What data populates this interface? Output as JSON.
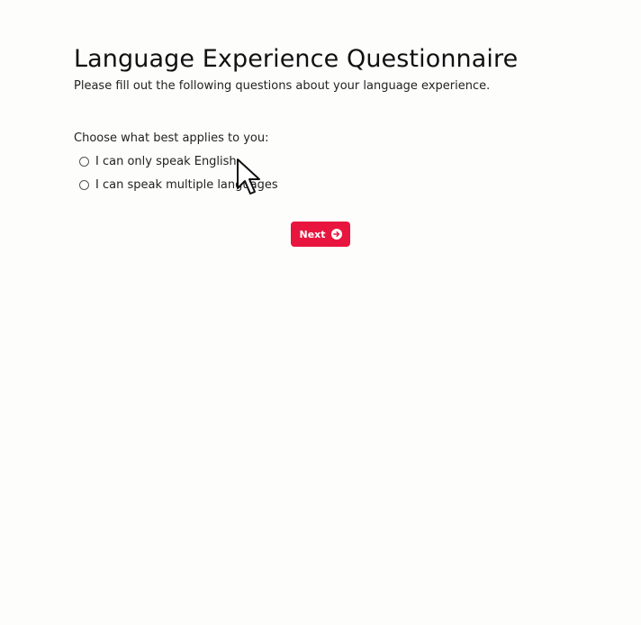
{
  "page": {
    "title": "Language Experience Questionnaire",
    "subtitle": "Please fill out the following questions about your language experience."
  },
  "question": {
    "label": "Choose what best applies to you:",
    "options": [
      {
        "label": "I can only speak English",
        "selected": false
      },
      {
        "label": "I can speak multiple languages",
        "selected": false
      }
    ]
  },
  "actions": {
    "next_label": "Next",
    "next_icon": "arrow-circle-right-icon",
    "accent_color": "#e8163f"
  },
  "cursor": {
    "icon": "mouse-pointer-icon"
  }
}
